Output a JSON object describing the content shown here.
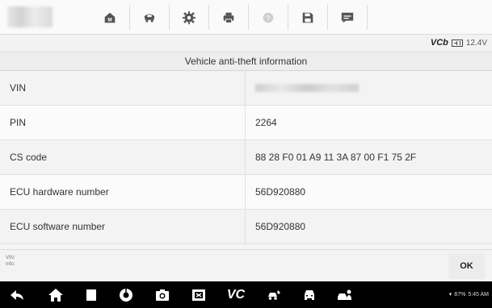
{
  "toolbar": {
    "buttons": [
      {
        "name": "home-button",
        "icon": "home-icon"
      },
      {
        "name": "vehicle-swap-button",
        "icon": "car-swap-icon"
      },
      {
        "name": "settings-button",
        "icon": "gear-icon"
      },
      {
        "name": "print-button",
        "icon": "printer-icon"
      },
      {
        "name": "help-button",
        "icon": "help-icon"
      },
      {
        "name": "save-button",
        "icon": "save-icon"
      },
      {
        "name": "data-logging-button",
        "icon": "message-icon"
      }
    ]
  },
  "status": {
    "vci_label": "VCb",
    "voltage": "12.4V"
  },
  "table": {
    "title": "Vehicle anti-theft information",
    "rows": [
      {
        "label": "VIN",
        "value": ""
      },
      {
        "label": "PIN",
        "value": "2264"
      },
      {
        "label": "CS code",
        "value": "88 28 F0 01 A9 11 3A 87 00 F1 75 2F"
      },
      {
        "label": "ECU hardware number",
        "value": "56D920880"
      },
      {
        "label": "ECU software number",
        "value": "56D920880"
      }
    ]
  },
  "info": {
    "line1": "VIN:",
    "line2": "Info:"
  },
  "ok_label": "OK",
  "navbar": {
    "vci_label": "VC",
    "battery": "87%",
    "time": "5:45 AM"
  },
  "colors": {
    "toolbar_bg": "#fafafa",
    "navbar_bg": "#000000",
    "ok_bg": "#ececec"
  }
}
